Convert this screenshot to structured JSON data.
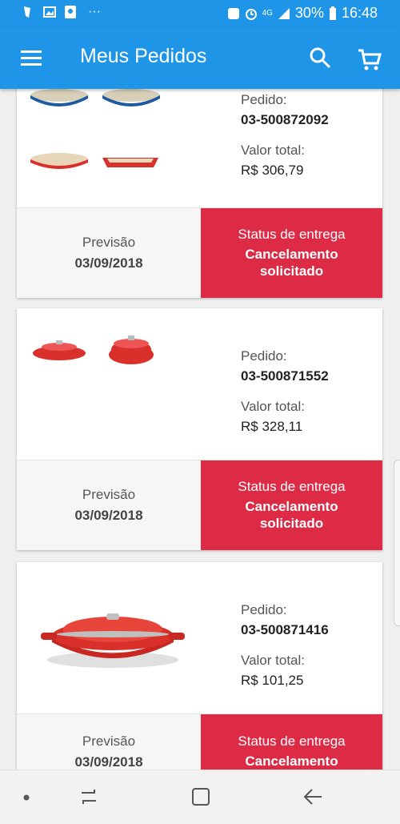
{
  "status_bar": {
    "battery": "30%",
    "time": "16:48",
    "network": "4G",
    "overflow": "···"
  },
  "app_bar": {
    "title": "Meus Pedidos",
    "icons": [
      "menu-icon",
      "search-icon",
      "cart-icon"
    ]
  },
  "orders": [
    {
      "pedido_label": "Pedido:",
      "pedido_number": "03-500872092",
      "valor_label": "Valor total:",
      "valor": "R$ 306,79",
      "previsao_label": "Previsão",
      "previsao_date": "03/09/2018",
      "status_label": "Status de entrega",
      "status_value": "Cancelamento solicitado"
    },
    {
      "pedido_label": "Pedido:",
      "pedido_number": "03-500871552",
      "valor_label": "Valor total:",
      "valor": "R$ 328,11",
      "previsao_label": "Previsão",
      "previsao_date": "03/09/2018",
      "status_label": "Status de entrega",
      "status_value": "Cancelamento solicitado"
    },
    {
      "pedido_label": "Pedido:",
      "pedido_number": "03-500871416",
      "valor_label": "Valor total:",
      "valor": "R$ 101,25",
      "previsao_label": "Previsão",
      "previsao_date": "03/09/2018",
      "status_label": "Status de entrega",
      "status_value": "Cancelamento"
    }
  ],
  "colors": {
    "primary": "#1f95e8",
    "status_red": "#dd2a45",
    "product_red": "#d9302c",
    "product_blue": "#1e5aa0"
  },
  "nav_icons": [
    "dot-icon",
    "recent-apps-icon",
    "home-icon",
    "back-icon"
  ]
}
